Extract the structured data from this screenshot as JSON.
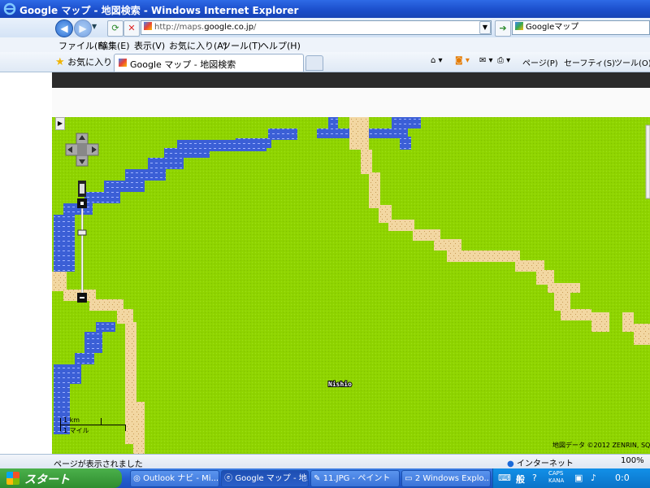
{
  "window": {
    "title": "Google マップ - 地図検索 - Windows Internet Explorer",
    "url_prefix": "http://maps.",
    "url_host": "google.co.jp",
    "url_suffix": "/",
    "search_text": "Googleマップ"
  },
  "menu": [
    "ファイル(F)",
    "編集(E)",
    "表示(V)",
    "お気に入り(A)",
    "ツール(T)",
    "ヘルプ(H)"
  ],
  "favbar": {
    "favorites_label": "お気に入り",
    "tab_title": "Google マップ - 地図検索",
    "tools": [
      "ページ(P)",
      "セーフティ(S)",
      "ツール(O)"
    ]
  },
  "map": {
    "place_label": "Nishio",
    "scale_km": "1 km",
    "scale_mile": "1 マイル",
    "copyright": "地図データ ©2012 ZENRIN, SQ",
    "colors": {
      "land": "#8fd400",
      "water": "#3b5fd6",
      "road": "#f2d7a2"
    }
  },
  "status": {
    "text": "ページが表示されました",
    "zone": "インターネット",
    "zoom": "100%"
  },
  "taskbar": {
    "start": "スタート",
    "tasks": [
      "Outlook ナビ - Mi...",
      "Google マップ - 地...",
      "11.JPG - ペイント",
      "2 Windows Explo..."
    ],
    "tray_caps": "CAPS",
    "tray_kana": "KANA",
    "ime": "般",
    "clock": "0:0"
  }
}
